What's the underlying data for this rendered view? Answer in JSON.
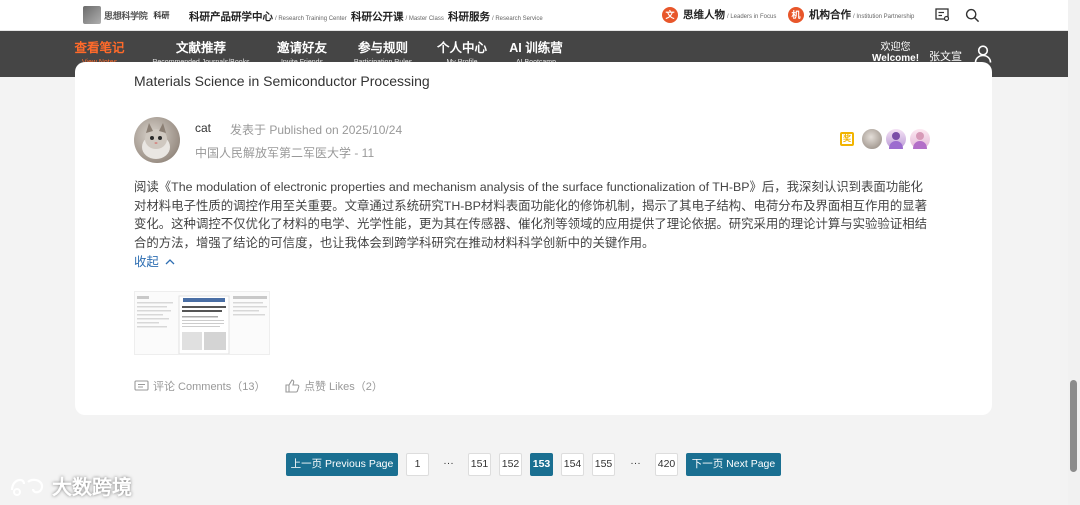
{
  "top": {
    "logo_text": "思想科学院",
    "logo_sub": "科研",
    "nav": [
      {
        "zh": "科研产品研学中心",
        "en": "/ Research Training Center"
      },
      {
        "zh": "科研公开课",
        "en": "/ Master Class"
      },
      {
        "zh": "科研服务",
        "en": "/ Research Service"
      }
    ],
    "leaders": {
      "icon": "文",
      "zh": "思维人物",
      "en": "/ Leaders in Focus"
    },
    "partner": {
      "icon": "机",
      "zh": "机构合作",
      "en": "/ Institution Partnership"
    }
  },
  "menu": [
    {
      "zh": "查看笔记",
      "en": "View Notes"
    },
    {
      "zh": "文献推荐",
      "en": "Recommended Journals/Books"
    },
    {
      "zh": "邀请好友",
      "en": "Invite Friends"
    },
    {
      "zh": "参与规则",
      "en": "Participation Rules"
    },
    {
      "zh": "个人中心",
      "en": "My Profile"
    },
    {
      "zh": "AI 训练营",
      "en": "AI Bootcamp"
    }
  ],
  "user": {
    "welcome_zh": "欢迎您",
    "welcome_en": "Welcome!",
    "name": "张文宣"
  },
  "post": {
    "title": "Materials Science in Semiconductor Processing",
    "author": "cat",
    "published": "发表于 Published on 2025/10/24",
    "school": "中国人民解放军第二军医大学 - 11",
    "body": "阅读《The modulation of electronic properties and mechanism analysis of the surface functionalization of TH-BP》后，我深刻认识到表面功能化对材料电子性质的调控作用至关重要。文章通过系统研究TH-BP材料表面功能化的修饰机制，揭示了其电子结构、电荷分布及界面相互作用的显著变化。这种调控不仅优化了材料的电学、光学性能，更为其在传感器、催化剂等领域的应用提供了理论依据。研究采用的理论计算与实验验证相结合的方法，增强了结论的可信度，也让我体会到跨学科研究在推动材料科学创新中的关键作用。",
    "collapse": "收起",
    "comments": "评论 Comments（13）",
    "likes": "点赞 Likes（2）",
    "medal": "奖"
  },
  "pager": {
    "prev": "上一页 Previous Page",
    "next": "下一页 Next Page",
    "p1": "1",
    "dots1": "···",
    "p151": "151",
    "p152": "152",
    "p153": "153",
    "p154": "154",
    "p155": "155",
    "dots2": "···",
    "p420": "420"
  },
  "watermark": "大数跨境",
  "colors": {
    "accent": "#ff5a1f",
    "nav_bg": "#454545",
    "pager": "#1a6f91",
    "link": "#2f6fb3"
  }
}
